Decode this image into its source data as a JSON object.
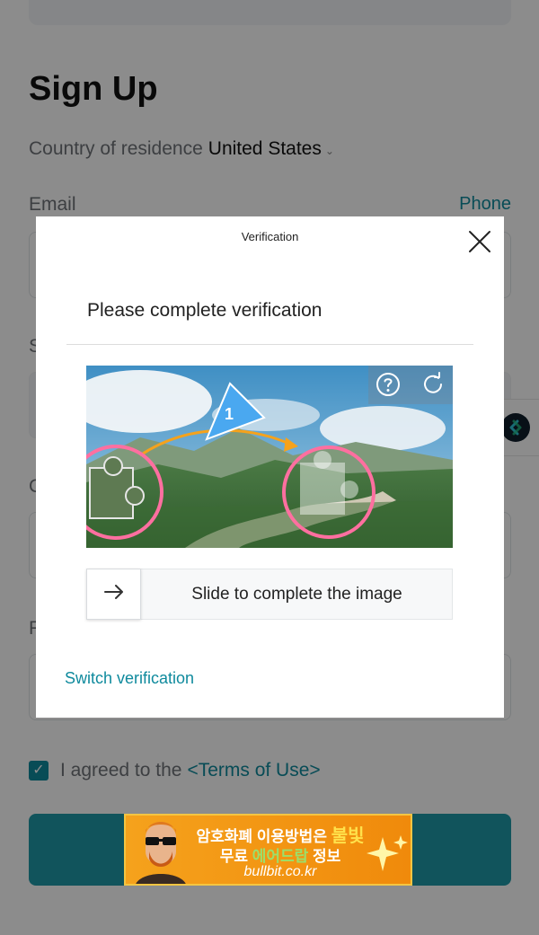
{
  "page": {
    "title": "Sign Up",
    "country_label": "Country of residence",
    "country_value": "United States",
    "email_label": "Email",
    "phone_link": "Phone",
    "agree_prefix": "I agreed to the",
    "terms_link": "<Terms of Use>",
    "label_fragments": [
      "S",
      "C",
      "F"
    ]
  },
  "modal": {
    "header": "Verification",
    "subtitle": "Please complete verification",
    "slider_text": "Slide to complete the image",
    "switch_link": "Switch verification",
    "step_badge": "1"
  },
  "ad": {
    "line1_a": "암호화폐 이용방법은 ",
    "line1_b": "불빛",
    "line2_a": "무료 ",
    "line2_b": "에어드랍",
    "line2_c": " 정보",
    "url": "bullbit.co.kr"
  },
  "colors": {
    "accent": "#0f8a9d",
    "primary_button": "#1f9aa8",
    "puzzle_highlight": "#ff6fa0",
    "hint_arrow": "#f5a21c",
    "hint_badge": "#4aa8f0"
  },
  "icons": {
    "close": "close-icon",
    "help": "question-mark-icon",
    "refresh": "refresh-icon",
    "slider": "arrow-right-icon",
    "side": "swap-arrows-icon",
    "checkbox": "checkmark-icon"
  }
}
